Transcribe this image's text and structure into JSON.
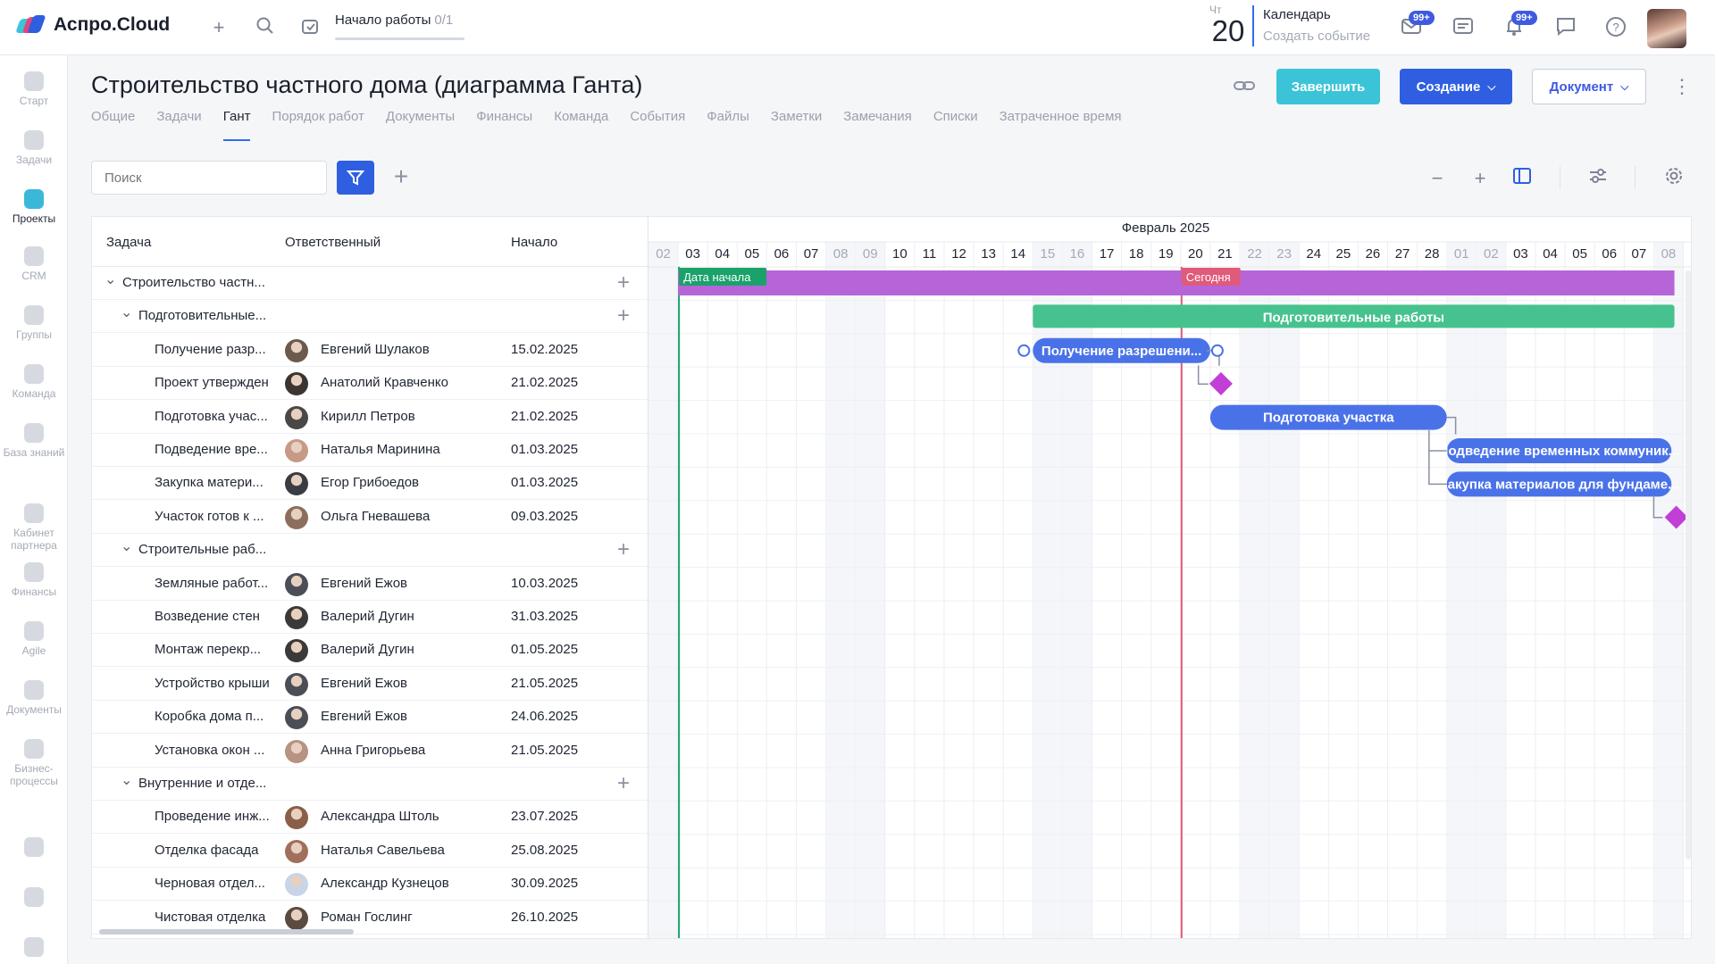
{
  "app": {
    "logo_text": "Аспро.Cloud",
    "onboarding": {
      "label": "Начало работы",
      "count": "0/1"
    },
    "calendar": {
      "dow": "Чт",
      "day": "20",
      "title": "Календарь",
      "subtitle": "Создать событие"
    },
    "badges": {
      "mail": "99+",
      "notifications": "99+"
    }
  },
  "sidebar": {
    "items": [
      {
        "label": "Старт",
        "color": "#d6d9df"
      },
      {
        "label": "Задачи",
        "color": "#d6d9df"
      },
      {
        "label": "Проекты",
        "color": "#3bb8d8"
      },
      {
        "label": "CRM",
        "color": "#d6d9df"
      },
      {
        "label": "Группы",
        "color": "#d6d9df"
      },
      {
        "label": "Команда",
        "color": "#d6d9df"
      },
      {
        "label": "База знаний",
        "color": "#d6d9df"
      },
      {
        "label": "Кабинет партнера",
        "color": "#d6d9df"
      },
      {
        "label": "Финансы",
        "color": "#d6d9df"
      },
      {
        "label": "Agile",
        "color": "#d6d9df"
      },
      {
        "label": "Документы",
        "color": "#d6d9df"
      },
      {
        "label": "Бизнес-процессы",
        "color": "#d6d9df"
      }
    ],
    "active": "Проекты"
  },
  "project": {
    "title": "Строительство частного дома (диаграмма Ганта)",
    "tabs": [
      "Общие",
      "Задачи",
      "Гант",
      "Порядок работ",
      "Документы",
      "Финансы",
      "Команда",
      "События",
      "Файлы",
      "Заметки",
      "Замечания",
      "Списки",
      "Затраченное время"
    ],
    "active_tab": "Гант",
    "buttons": {
      "finish": "Завершить",
      "create": "Создание",
      "document": "Документ"
    }
  },
  "toolbar": {
    "search_placeholder": "Поиск"
  },
  "colors": {
    "accent": "#2f5fe0",
    "finish": "#3bc4d8",
    "project_bar": "#b565d8",
    "group_bar": "#46c28e",
    "task_bar": "#4a72e8",
    "milestone": "#c13fd6",
    "today": "#e05a7a",
    "start_line": "#1aa26a"
  },
  "grid": {
    "columns": {
      "task": "Задача",
      "responsible": "Ответственный",
      "start": "Начало"
    },
    "rows": [
      {
        "type": "project",
        "name": "Строительство частн...",
        "level": 0
      },
      {
        "type": "group",
        "name": "Подготовительные...",
        "level": 1
      },
      {
        "type": "task",
        "name": "Получение разр...",
        "responsible": "Евгений Шулаков",
        "start": "15.02.2025",
        "avatar": "#6b5a4e"
      },
      {
        "type": "task",
        "name": "Проект утвержден",
        "responsible": "Анатолий Кравченко",
        "start": "21.02.2025",
        "avatar": "#3b3430"
      },
      {
        "type": "task",
        "name": "Подготовка учас...",
        "responsible": "Кирилл Петров",
        "start": "21.02.2025",
        "avatar": "#4a4744"
      },
      {
        "type": "task",
        "name": "Подведение вре...",
        "responsible": "Наталья Маринина",
        "start": "01.03.2025",
        "avatar": "#c79a86"
      },
      {
        "type": "task",
        "name": "Закупка матери...",
        "responsible": "Егор Грибоедов",
        "start": "01.03.2025",
        "avatar": "#3a3c44"
      },
      {
        "type": "task",
        "name": "Участок готов к ...",
        "responsible": "Ольга Гневашева",
        "start": "09.03.2025",
        "avatar": "#8c6e5c"
      },
      {
        "type": "group",
        "name": "Строительные раб...",
        "level": 1
      },
      {
        "type": "task",
        "name": "Земляные работ...",
        "responsible": "Евгений Ежов",
        "start": "10.03.2025",
        "avatar": "#4a4e56"
      },
      {
        "type": "task",
        "name": "Возведение стен",
        "responsible": "Валерий Дугин",
        "start": "31.03.2025",
        "avatar": "#3c3a38"
      },
      {
        "type": "task",
        "name": "Монтаж перекр...",
        "responsible": "Валерий Дугин",
        "start": "01.05.2025",
        "avatar": "#3c3a38"
      },
      {
        "type": "task",
        "name": "Устройство крыши",
        "responsible": "Евгений Ежов",
        "start": "21.05.2025",
        "avatar": "#4a4e56"
      },
      {
        "type": "task",
        "name": "Коробка дома п...",
        "responsible": "Евгений Ежов",
        "start": "24.06.2025",
        "avatar": "#4a4e56"
      },
      {
        "type": "task",
        "name": "Установка окон ...",
        "responsible": "Анна Григорьева",
        "start": "21.05.2025",
        "avatar": "#b89282"
      },
      {
        "type": "group",
        "name": "Внутренние и отде...",
        "level": 1
      },
      {
        "type": "task",
        "name": "Проведение инж...",
        "responsible": "Александра Штоль",
        "start": "23.07.2025",
        "avatar": "#8a5e48"
      },
      {
        "type": "task",
        "name": "Отделка фасада",
        "responsible": "Наталья Савельева",
        "start": "25.08.2025",
        "avatar": "#a0705c"
      },
      {
        "type": "task",
        "name": "Черновая отдел...",
        "responsible": "Александр Кузнецов",
        "start": "30.09.2025",
        "avatar": "#c8d4e8"
      },
      {
        "type": "task",
        "name": "Чистовая отделка",
        "responsible": "Роман Гослинг",
        "start": "26.10.2025",
        "avatar": "#5a4a40"
      }
    ]
  },
  "timeline": {
    "month_label": "Февраль 2025",
    "days": [
      "02",
      "03",
      "04",
      "05",
      "06",
      "07",
      "08",
      "09",
      "10",
      "11",
      "12",
      "13",
      "14",
      "15",
      "16",
      "17",
      "18",
      "19",
      "20",
      "21",
      "22",
      "23",
      "24",
      "25",
      "26",
      "27",
      "28",
      "01",
      "02",
      "03",
      "04",
      "05",
      "06",
      "07",
      "08"
    ],
    "weekend_indices": [
      0,
      6,
      7,
      13,
      14,
      20,
      21,
      27,
      28,
      34
    ],
    "today_index": 18,
    "start_index": 1,
    "markers": {
      "start": "Дата начала",
      "today": "Сегодня"
    },
    "bars": [
      {
        "row": 0,
        "kind": "project",
        "from": 1,
        "to": 34.7,
        "label": ""
      },
      {
        "row": 1,
        "kind": "group",
        "from": 13,
        "to": 34.7,
        "label": "Подготовительные работы"
      },
      {
        "row": 2,
        "kind": "task",
        "from": 13,
        "to": 19,
        "label": "Получение разрешени..."
      },
      {
        "row": 3,
        "kind": "milestone",
        "at": 19
      },
      {
        "row": 4,
        "kind": "task",
        "from": 19,
        "to": 27,
        "label": "Подготовка участка"
      },
      {
        "row": 5,
        "kind": "task",
        "from": 27,
        "to": 34.6,
        "label": "Подведение временных коммуник..."
      },
      {
        "row": 6,
        "kind": "task",
        "from": 27,
        "to": 34.6,
        "label": "Закупка материалов для фундаме..."
      },
      {
        "row": 7,
        "kind": "milestone",
        "at": 34.4
      }
    ]
  }
}
